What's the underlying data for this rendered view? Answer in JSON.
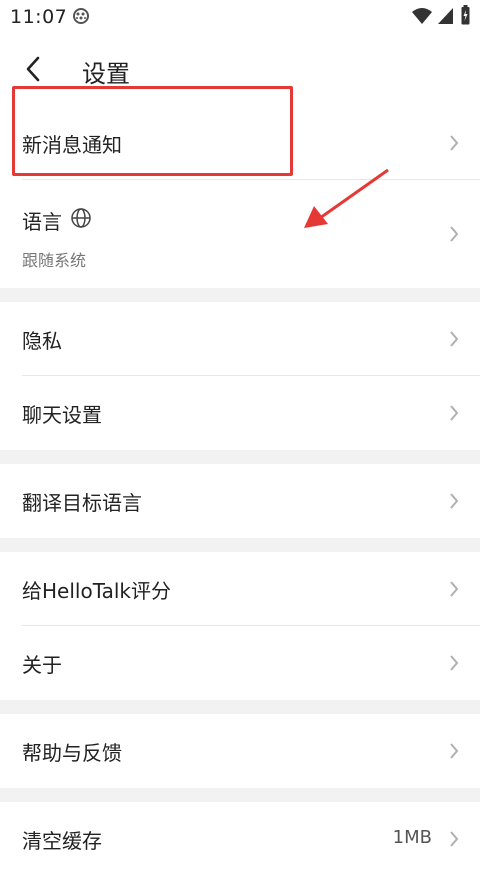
{
  "statusbar": {
    "time": "11:07",
    "icons": [
      "notification-icon",
      "wifi-icon",
      "signal-icon",
      "battery-icon"
    ]
  },
  "header": {
    "back_icon": "chevron-left-icon",
    "title": "设置"
  },
  "settings": {
    "new_message_notification": "新消息通知",
    "language": {
      "label": "语言",
      "icon": "globe-icon",
      "value": "跟随系统"
    },
    "privacy": "隐私",
    "chat_settings": "聊天设置",
    "translate_target_language": "翻译目标语言",
    "rate_hellotalk": "给HelloTalk评分",
    "about": "关于",
    "help_feedback": "帮助与反馈",
    "clear_cache": {
      "label": "清空缓存",
      "value": "1MB"
    }
  },
  "colors": {
    "highlight": "#e53935",
    "background": "#f2f2f2",
    "row": "#ffffff",
    "text": "#222222",
    "subtext": "#777777"
  }
}
